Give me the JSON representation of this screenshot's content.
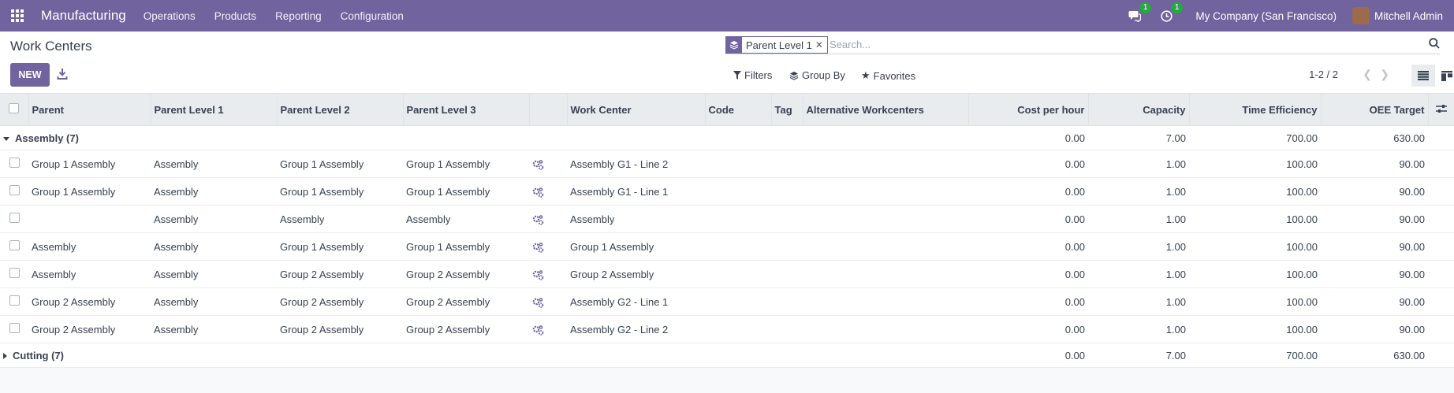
{
  "navbar": {
    "app_name": "Manufacturing",
    "menus": [
      "Operations",
      "Products",
      "Reporting",
      "Configuration"
    ],
    "messages_badge": "1",
    "activities_badge": "1",
    "company": "My Company (San Francisco)",
    "user": "Mitchell Admin"
  },
  "control_panel": {
    "title": "Work Centers",
    "new_label": "NEW",
    "facet_label": "Parent Level 1",
    "search_placeholder": "Search...",
    "filters_label": "Filters",
    "groupby_label": "Group By",
    "favorites_label": "Favorites",
    "pager": "1-2 / 2"
  },
  "table": {
    "headers": {
      "parent": "Parent",
      "parent_level_1": "Parent Level 1",
      "parent_level_2": "Parent Level 2",
      "parent_level_3": "Parent Level 3",
      "work_center": "Work Center",
      "code": "Code",
      "tag": "Tag",
      "alternative": "Alternative Workcenters",
      "cost": "Cost per hour",
      "capacity": "Capacity",
      "efficiency": "Time Efficiency",
      "oee": "OEE Target"
    },
    "groups": [
      {
        "label": "Assembly (7)",
        "expanded": true,
        "cost": "0.00",
        "capacity": "7.00",
        "efficiency": "700.00",
        "oee": "630.00"
      },
      {
        "label": "Cutting (7)",
        "expanded": false,
        "cost": "0.00",
        "capacity": "7.00",
        "efficiency": "700.00",
        "oee": "630.00"
      }
    ],
    "rows": [
      {
        "parent": "Group 1 Assembly",
        "l1": "Assembly",
        "l2": "Group 1 Assembly",
        "l3": "Group 1 Assembly",
        "wc": "Assembly G1 - Line 2",
        "cost": "0.00",
        "capacity": "1.00",
        "efficiency": "100.00",
        "oee": "90.00"
      },
      {
        "parent": "Group 1 Assembly",
        "l1": "Assembly",
        "l2": "Group 1 Assembly",
        "l3": "Group 1 Assembly",
        "wc": "Assembly G1 - Line 1",
        "cost": "0.00",
        "capacity": "1.00",
        "efficiency": "100.00",
        "oee": "90.00"
      },
      {
        "parent": "",
        "l1": "Assembly",
        "l2": "Assembly",
        "l3": "Assembly",
        "wc": "Assembly",
        "cost": "0.00",
        "capacity": "1.00",
        "efficiency": "100.00",
        "oee": "90.00"
      },
      {
        "parent": "Assembly",
        "l1": "Assembly",
        "l2": "Group 1 Assembly",
        "l3": "Group 1 Assembly",
        "wc": "Group 1 Assembly",
        "cost": "0.00",
        "capacity": "1.00",
        "efficiency": "100.00",
        "oee": "90.00"
      },
      {
        "parent": "Assembly",
        "l1": "Assembly",
        "l2": "Group 2 Assembly",
        "l3": "Group 2 Assembly",
        "wc": "Group 2 Assembly",
        "cost": "0.00",
        "capacity": "1.00",
        "efficiency": "100.00",
        "oee": "90.00"
      },
      {
        "parent": "Group 2 Assembly",
        "l1": "Assembly",
        "l2": "Group 2 Assembly",
        "l3": "Group 2 Assembly",
        "wc": "Assembly G2 - Line 1",
        "cost": "0.00",
        "capacity": "1.00",
        "efficiency": "100.00",
        "oee": "90.00"
      },
      {
        "parent": "Group 2 Assembly",
        "l1": "Assembly",
        "l2": "Group 2 Assembly",
        "l3": "Group 2 Assembly",
        "wc": "Assembly G2 - Line 2",
        "cost": "0.00",
        "capacity": "1.00",
        "efficiency": "100.00",
        "oee": "90.00"
      }
    ]
  },
  "colors": {
    "brand": "#71639e",
    "badge": "#28a745"
  }
}
